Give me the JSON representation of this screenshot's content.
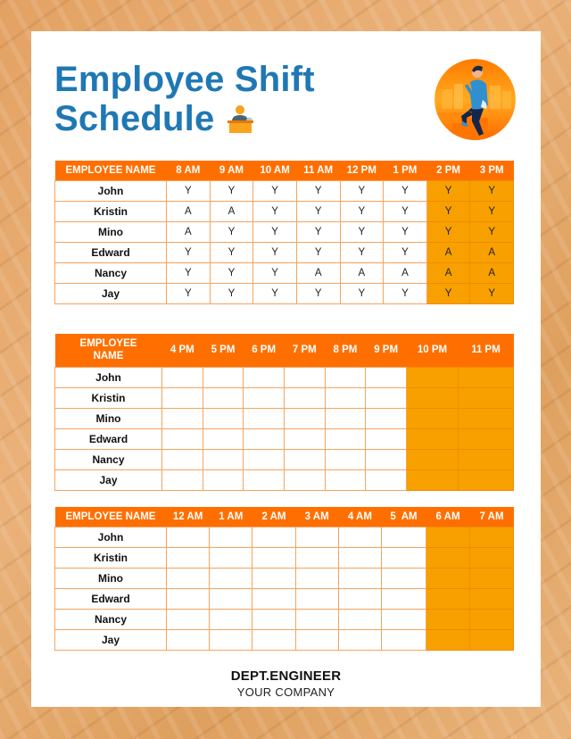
{
  "title": {
    "line1": "Employee Shift",
    "line2": "Schedule"
  },
  "icons": {
    "title_icon": "reception-desk-icon",
    "avatar": "man-climbing-stairs-illustration"
  },
  "colors": {
    "title_blue": "#1f78b4",
    "header_orange": "#ff6f00",
    "highlight_orange": "#f7a000",
    "grid_line": "#f6a35e"
  },
  "employees": [
    "John",
    "Kristin",
    "Mino",
    "Edward",
    "Nancy",
    "Jay"
  ],
  "tables": [
    {
      "name_header": "EMPLOYEE NAME",
      "hours": [
        "8 AM",
        "9 AM",
        "10 AM",
        "11 AM",
        "12 PM",
        "1 PM",
        "2 PM",
        "3 PM"
      ],
      "highlighted_hours": [
        "2 PM",
        "3 PM"
      ],
      "rows": [
        {
          "name": "John",
          "values": [
            "Y",
            "Y",
            "Y",
            "Y",
            "Y",
            "Y",
            "Y",
            "Y"
          ]
        },
        {
          "name": "Kristin",
          "values": [
            "A",
            "A",
            "Y",
            "Y",
            "Y",
            "Y",
            "Y",
            "Y"
          ]
        },
        {
          "name": "Mino",
          "values": [
            "A",
            "Y",
            "Y",
            "Y",
            "Y",
            "Y",
            "Y",
            "Y"
          ]
        },
        {
          "name": "Edward",
          "values": [
            "Y",
            "Y",
            "Y",
            "Y",
            "Y",
            "Y",
            "A",
            "A"
          ]
        },
        {
          "name": "Nancy",
          "values": [
            "Y",
            "Y",
            "Y",
            "A",
            "A",
            "A",
            "A",
            "A"
          ]
        },
        {
          "name": "Jay",
          "values": [
            "Y",
            "Y",
            "Y",
            "Y",
            "Y",
            "Y",
            "Y",
            "Y"
          ]
        }
      ]
    },
    {
      "name_header": "EMPLOYEE NAME",
      "hours": [
        "4 PM",
        "5 PM",
        "6 PM",
        "7 PM",
        "8 PM",
        "9 PM",
        "10 PM",
        "11 PM"
      ],
      "highlighted_hours": [
        "10 PM",
        "11 PM"
      ],
      "rows": [
        {
          "name": "John",
          "values": [
            "",
            "",
            "",
            "",
            "",
            "",
            "",
            ""
          ]
        },
        {
          "name": "Kristin",
          "values": [
            "",
            "",
            "",
            "",
            "",
            "",
            "",
            ""
          ]
        },
        {
          "name": "Mino",
          "values": [
            "",
            "",
            "",
            "",
            "",
            "",
            "",
            ""
          ]
        },
        {
          "name": "Edward",
          "values": [
            "",
            "",
            "",
            "",
            "",
            "",
            "",
            ""
          ]
        },
        {
          "name": "Nancy",
          "values": [
            "",
            "",
            "",
            "",
            "",
            "",
            "",
            ""
          ]
        },
        {
          "name": "Jay",
          "values": [
            "",
            "",
            "",
            "",
            "",
            "",
            "",
            ""
          ]
        }
      ]
    },
    {
      "name_header": "EMPLOYEE NAME",
      "hours": [
        "12 AM",
        "1 AM",
        "2 AM",
        "3 AM",
        "4 AM",
        "5  AM",
        "6 AM",
        "7 AM"
      ],
      "highlighted_hours": [
        "6 AM",
        "7 AM"
      ],
      "rows": [
        {
          "name": "John",
          "values": [
            "",
            "",
            "",
            "",
            "",
            "",
            "",
            ""
          ]
        },
        {
          "name": "Kristin",
          "values": [
            "",
            "",
            "",
            "",
            "",
            "",
            "",
            ""
          ]
        },
        {
          "name": "Mino",
          "values": [
            "",
            "",
            "",
            "",
            "",
            "",
            "",
            ""
          ]
        },
        {
          "name": "Edward",
          "values": [
            "",
            "",
            "",
            "",
            "",
            "",
            "",
            ""
          ]
        },
        {
          "name": "Nancy",
          "values": [
            "",
            "",
            "",
            "",
            "",
            "",
            "",
            ""
          ]
        },
        {
          "name": "Jay",
          "values": [
            "",
            "",
            "",
            "",
            "",
            "",
            "",
            ""
          ]
        }
      ]
    }
  ],
  "footer": {
    "department": "DEPT.ENGINEER",
    "company": "YOUR COMPANY"
  }
}
